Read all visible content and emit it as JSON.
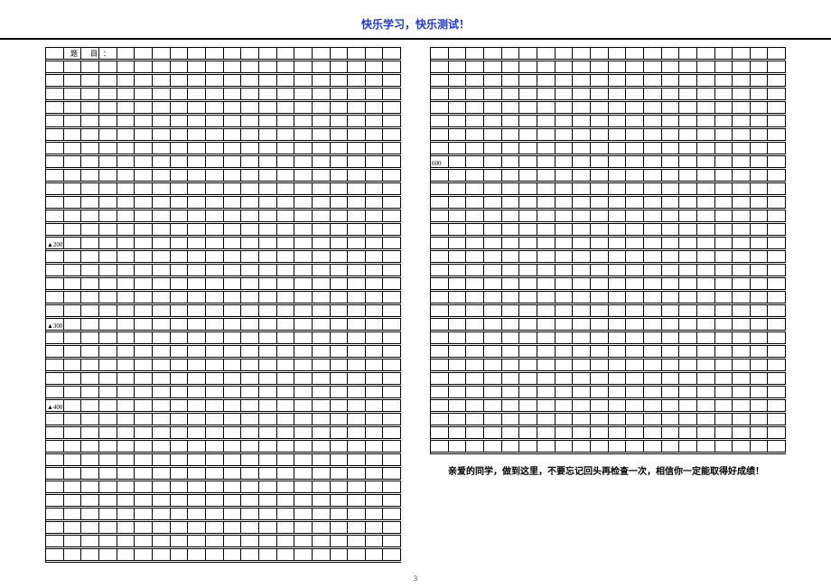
{
  "header": {
    "title": "快乐学习，快乐测试！"
  },
  "essay": {
    "title_label": "题 目：",
    "markers": {
      "m200": "▲200",
      "m300": "▲300",
      "m400": "▲400",
      "m600": "600"
    }
  },
  "footer_message": "亲爱的同学，做到这里，不要忘记回头再检查一次，相信你一定能取得好成绩！",
  "page_number": "3"
}
